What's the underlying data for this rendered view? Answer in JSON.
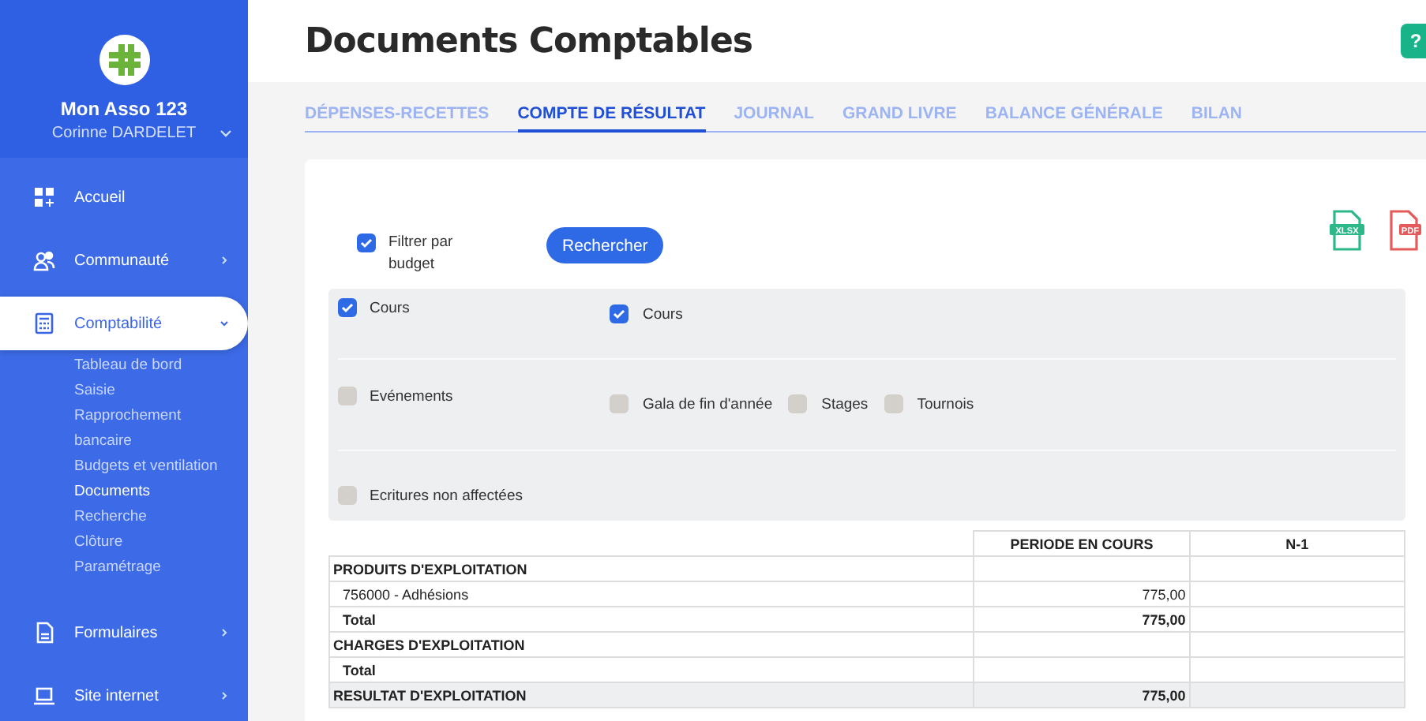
{
  "sidebar": {
    "org_name": "Mon Asso 123",
    "user_name": "Corinne DARDELET",
    "items": [
      {
        "kind": "home",
        "label": "Accueil",
        "chevron": false,
        "selected": false
      },
      {
        "kind": "people",
        "label": "Communauté",
        "chevron": true,
        "selected": false
      },
      {
        "kind": "calculator",
        "label": "Comptabilité",
        "chevron": true,
        "selected": true,
        "children": [
          {
            "label": "Tableau de bord",
            "selected": false
          },
          {
            "label": "Saisie",
            "selected": false
          },
          {
            "label": "Rapprochement bancaire",
            "selected": false
          },
          {
            "label": "Budgets et ventilation",
            "selected": false
          },
          {
            "label": "Documents",
            "selected": true
          },
          {
            "label": "Recherche",
            "selected": false
          },
          {
            "label": "Clôture",
            "selected": false
          },
          {
            "label": "Paramétrage",
            "selected": false
          }
        ]
      },
      {
        "kind": "document",
        "label": "Formulaires",
        "chevron": true,
        "selected": false
      },
      {
        "kind": "laptop",
        "label": "Site internet",
        "chevron": true,
        "selected": false
      }
    ]
  },
  "page": {
    "title": "Documents Comptables",
    "help_button": "?"
  },
  "tabs": [
    {
      "label": "DÉPENSES-RECETTES",
      "selected": false
    },
    {
      "label": "COMPTE DE RÉSULTAT",
      "selected": true
    },
    {
      "label": "JOURNAL",
      "selected": false
    },
    {
      "label": "GRAND LIVRE",
      "selected": false
    },
    {
      "label": "BALANCE GÉNÉRALE",
      "selected": false
    },
    {
      "label": "BILAN",
      "selected": false
    }
  ],
  "filter": {
    "label": "Filtrer par budget",
    "checked": true,
    "search_button": "Rechercher",
    "export_icons": [
      {
        "kind": "xlsx",
        "label": "XLSX"
      },
      {
        "kind": "pdf",
        "label": "PDF"
      }
    ]
  },
  "budget_groups": [
    {
      "label": "Cours",
      "checked": true,
      "children": [
        {
          "label": "Cours",
          "checked": true
        }
      ]
    },
    {
      "label": "Evénements",
      "checked": false,
      "children": [
        {
          "label": "Gala de fin d'année",
          "checked": false
        },
        {
          "label": "Stages",
          "checked": false
        },
        {
          "label": "Tournois",
          "checked": false
        }
      ]
    },
    {
      "label": "Ecritures non affectées",
      "checked": false
    }
  ],
  "table": {
    "columns": [
      "PERIODE EN COURS",
      "N-1"
    ],
    "rows": [
      {
        "kind": "section",
        "label": "PRODUITS D'EXPLOITATION",
        "current": "",
        "previous": ""
      },
      {
        "kind": "item",
        "label": "756000 - Adhésions",
        "current": "775,00",
        "previous": ""
      },
      {
        "kind": "total",
        "label": "Total",
        "current": "775,00",
        "previous": ""
      },
      {
        "kind": "section",
        "label": "CHARGES D'EXPLOITATION",
        "current": "",
        "previous": ""
      },
      {
        "kind": "total",
        "label": "Total",
        "current": "",
        "previous": ""
      },
      {
        "kind": "result",
        "label": "RESULTAT D'EXPLOITATION",
        "current": "775,00",
        "previous": ""
      }
    ]
  }
}
